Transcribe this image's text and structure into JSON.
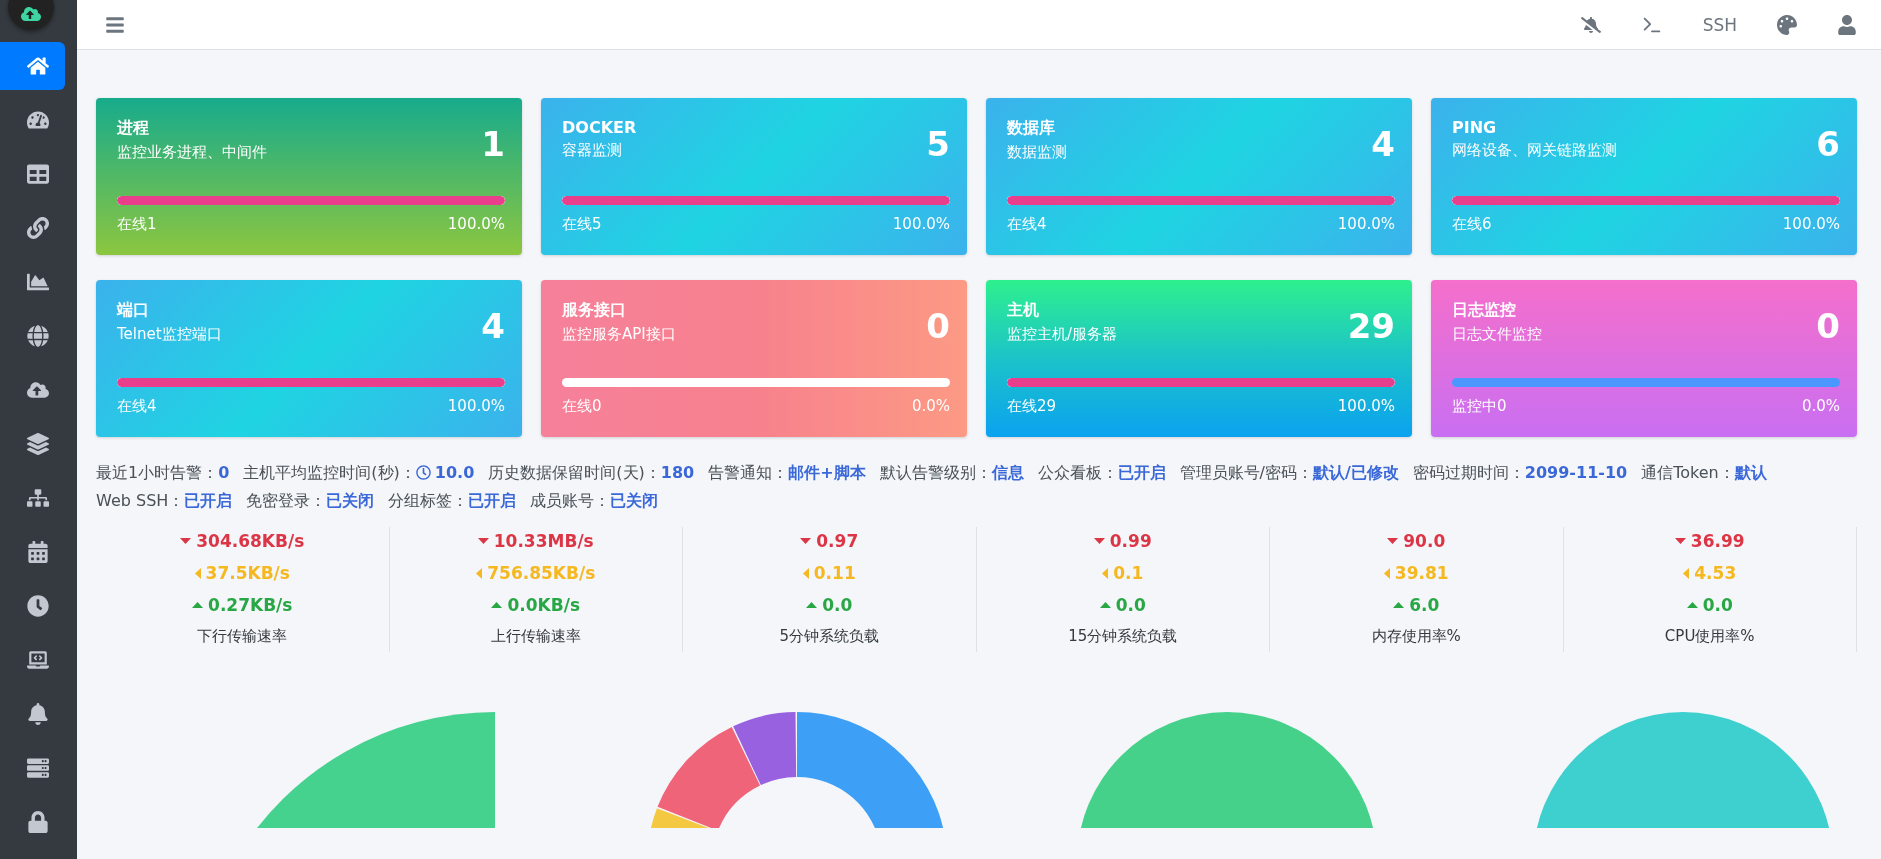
{
  "sidebar": {
    "items": [
      {
        "selected": true
      },
      {
        "selected": false
      },
      {
        "selected": false
      },
      {
        "selected": false
      },
      {
        "selected": false
      },
      {
        "selected": false
      },
      {
        "selected": false
      },
      {
        "selected": false
      },
      {
        "selected": false
      },
      {
        "selected": false
      },
      {
        "selected": false
      },
      {
        "selected": false
      },
      {
        "selected": false
      },
      {
        "selected": false
      },
      {
        "selected": false
      }
    ]
  },
  "topbar": {
    "ssh": "SSH"
  },
  "cards": [
    {
      "kind": "green",
      "title": "进程",
      "subtitle": "监控业务进程、中间件",
      "count": "1",
      "level": 1,
      "status": "在线1",
      "percent": "100.0%"
    },
    {
      "kind": "cyan",
      "title": "DOCKER",
      "subtitle": "容器监测",
      "count": "5",
      "level": 1,
      "status": "在线5",
      "percent": "100.0%"
    },
    {
      "kind": "cyan",
      "title": "数据库",
      "subtitle": "数据监测",
      "count": "4",
      "level": 1,
      "status": "在线4",
      "percent": "100.0%"
    },
    {
      "kind": "cyan",
      "title": "PING",
      "subtitle": "网络设备、网关链路监测",
      "count": "6",
      "level": 1,
      "status": "在线6",
      "percent": "100.0%"
    },
    {
      "kind": "cyan",
      "title": "端口",
      "subtitle": "Telnet监控端口",
      "count": "4",
      "level": 1,
      "status": "在线4",
      "percent": "100.0%"
    },
    {
      "kind": "coral",
      "title": "服务接口",
      "subtitle": "监控服务API接口",
      "count": "0",
      "level": 0,
      "status": "在线0",
      "percent": "0.0%"
    },
    {
      "kind": "mint",
      "title": "主机",
      "subtitle": "监控主机/服务器",
      "count": "29",
      "level": 1,
      "status": "在线29",
      "percent": "100.0%"
    },
    {
      "kind": "magenta",
      "title": "日志监控",
      "subtitle": "日志文件监控",
      "count": "0",
      "level": 0,
      "status": "监控中0",
      "percent": "0.0%"
    }
  ],
  "settings": [
    {
      "label": "最近1小时告警：",
      "value": "0"
    },
    {
      "label": "主机平均监控时间(秒)：",
      "value": "10.0",
      "clock": true
    },
    {
      "label": "历史数据保留时间(天)：",
      "value": "180"
    },
    {
      "label": "告警通知：",
      "value": "邮件+脚本"
    },
    {
      "label": "默认告警级别：",
      "value": "信息"
    },
    {
      "label": "公众看板：",
      "value": "已开启"
    },
    {
      "label": "管理员账号/密码：",
      "value": "默认/已修改"
    },
    {
      "label": "密码过期时间：",
      "value": "2099-11-10"
    },
    {
      "label": "通信Token：",
      "value": "默认"
    },
    {
      "label": "Web SSH：",
      "value": "已开启"
    },
    {
      "label": "免密登录：",
      "value": "已关闭"
    },
    {
      "label": "分组标签：",
      "value": "已开启"
    },
    {
      "label": "成员账号：",
      "value": "已关闭"
    }
  ],
  "stats": [
    {
      "max": "304.68KB/s",
      "avg": "37.5KB/s",
      "min": "0.27KB/s",
      "label": "下行传输速率"
    },
    {
      "max": "10.33MB/s",
      "avg": "756.85KB/s",
      "min": "0.0KB/s",
      "label": "上行传输速率"
    },
    {
      "max": "0.97",
      "avg": "0.11",
      "min": "0.0",
      "label": "5分钟系统负载"
    },
    {
      "max": "0.99",
      "avg": "0.1",
      "min": "0.0",
      "label": "15分钟系统负载"
    },
    {
      "max": "90.0",
      "avg": "39.81",
      "min": "6.0",
      "label": "内存使用率%"
    },
    {
      "max": "36.99",
      "avg": "4.53",
      "min": "0.0",
      "label": "CPU使用率%"
    }
  ]
}
